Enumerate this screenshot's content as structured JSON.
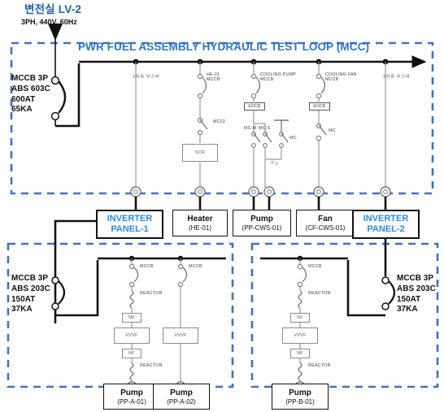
{
  "source": {
    "title": "변전실 LV-2",
    "spec": "3PH, 440V, 60Hz"
  },
  "mcc": {
    "title": "PWR FUEL ASSEMBLY HYDRAULIC TEST LOOP (MCC)",
    "main_breaker": "MCCB 3P\nABS 603C\n600AT\n65KA",
    "bus_label_left": "2차측 부스바",
    "bus_label_right": "2차측 부스바",
    "branches": {
      "heater": {
        "device_label": "HE-01\nMCCB",
        "contactor": "MC02",
        "controller": "SCR"
      },
      "cooling_pump": {
        "device_label": "COOLING PUMP\nMCCB",
        "relay": "EOCR",
        "main_contactor": "MC-M",
        "star_contactor": "MC-S",
        "delta_contactor": "MC",
        "starter_note": "Y-△"
      },
      "cooling_fan": {
        "device_label": "COOLING FAN\nMCCB",
        "relay": "EOCR",
        "contactor": "MC"
      }
    }
  },
  "loads": {
    "inverter_panel_1": {
      "line1": "INVERTER",
      "line2": "PANEL-1"
    },
    "heater": {
      "name": "Heater",
      "tag": "(HE-01)"
    },
    "pump_cws": {
      "name": "Pump",
      "tag": "(PP-CWS-01)"
    },
    "fan_cws": {
      "name": "Fan",
      "tag": "(CF-CWS-01)"
    },
    "inverter_panel_2": {
      "line1": "INVERTER",
      "line2": "PANEL-2"
    }
  },
  "panel_left": {
    "breaker": "MCCB 3P\nABS 203C\n150AT\n37KA",
    "feeders": [
      {
        "breaker": "MCCB",
        "reactor_in": "REACTOR",
        "filter_in": "NF",
        "drive": "VVVF",
        "filter_out": "NF",
        "reactor_out": "REACTOR",
        "load_name": "Pump",
        "load_tag": "(PP-A-01)"
      },
      {
        "breaker": "MCCB",
        "drive": "VVVF",
        "load_name": "Pump",
        "load_tag": "(PP-A-02)"
      }
    ]
  },
  "panel_right": {
    "breaker": "MCCB 3P\nABS 203C\n150AT\n37KA",
    "feeders": [
      {
        "breaker": "MCCB",
        "reactor_in": "REACTOR",
        "filter_in": "NF",
        "drive": "VVVF",
        "filter_out": "NF",
        "reactor_out": "REACTOR",
        "load_name": "Pump",
        "load_tag": "(PP-B-01)"
      }
    ]
  },
  "colors": {
    "accent_blue": "#2e75c4",
    "dash_blue": "#3f72c0",
    "wire_black": "#111111",
    "wire_gray": "#9a9a9a"
  }
}
